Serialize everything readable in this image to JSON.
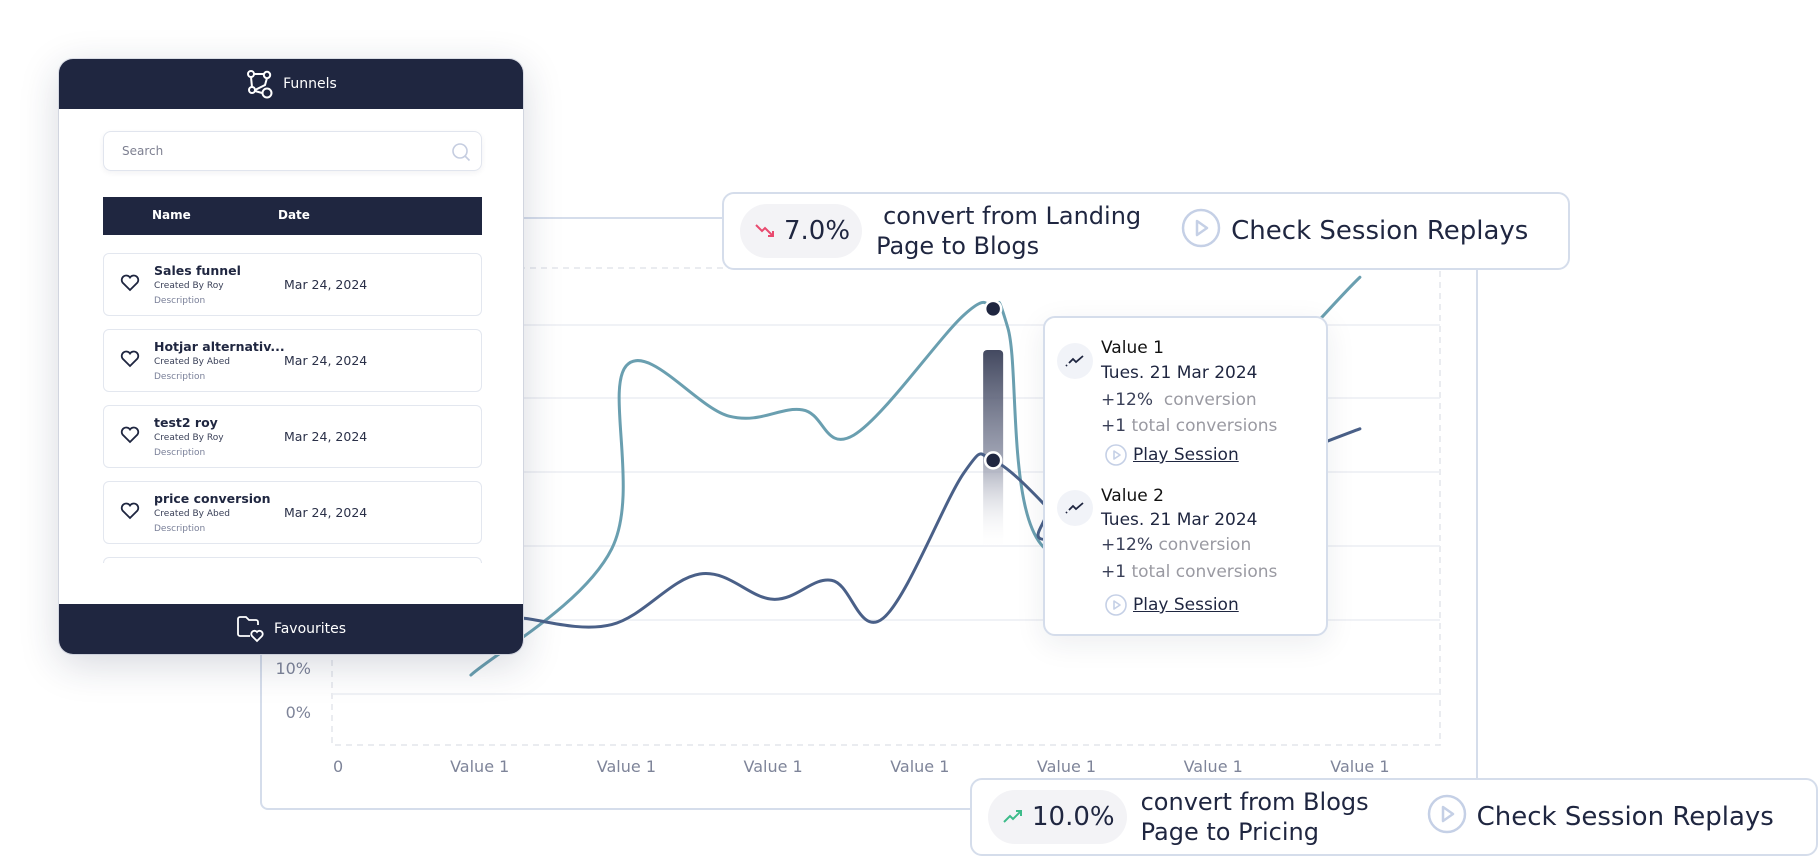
{
  "panel": {
    "title": "Funnels",
    "search_placeholder": "Search",
    "columns": {
      "name": "Name",
      "date": "Date"
    },
    "rows": [
      {
        "name": "Sales funnel",
        "creator": "Created By Roy",
        "description": "Description",
        "date": "Mar 24, 2024"
      },
      {
        "name": "Hotjar alternativ...",
        "creator": "Created By Abed",
        "description": "Description",
        "date": "Mar 24, 2024"
      },
      {
        "name": "test2 roy",
        "creator": "Created By Roy",
        "description": "Description",
        "date": "Mar 24, 2024"
      },
      {
        "name": "price conversion",
        "creator": "Created By Abed",
        "description": "Description",
        "date": "Mar 24, 2024"
      }
    ],
    "footer_label": "Favourites"
  },
  "banner_top": {
    "trend": "down",
    "trend_color": "#e94a6f",
    "percent": "7.0%",
    "text_line1": "convert from Landing",
    "text_line2": "Page to Blogs",
    "replay_label": "Check Session Replays"
  },
  "banner_bottom": {
    "trend": "up",
    "trend_color": "#3dbb8a",
    "percent": "10.0%",
    "text_line1": "convert from Blogs",
    "text_line2": "Page to Pricing",
    "replay_label": "Check Session Replays"
  },
  "tooltip": {
    "entries": [
      {
        "title": "Value 1",
        "date": "Tues. 21 Mar 2024",
        "conversion_value": "+12%",
        "conversion_label": "conversion",
        "total_value": "+1",
        "total_label": "total conversions",
        "play_label": "Play Session"
      },
      {
        "title": "Value 2",
        "date": "Tues. 21 Mar 2024",
        "conversion_value": "+12%",
        "conversion_label": "conversion",
        "total_value": "+1",
        "total_label": "total conversions",
        "play_label": "Play Session"
      }
    ]
  },
  "chart_data": {
    "type": "line",
    "title": "",
    "xlabel": "",
    "ylabel": "",
    "x": [
      0,
      1,
      2,
      3,
      4,
      5,
      6,
      7
    ],
    "x_tick_labels": [
      "0",
      "Value 1",
      "Value 1",
      "Value 1",
      "Value 1",
      "Value 1",
      "Value 1",
      "Value 1"
    ],
    "y_tick_labels_visible": [
      "10%",
      "0%"
    ],
    "ylim": [
      0,
      70
    ],
    "grid": true,
    "highlight_x": 4.5,
    "series": [
      {
        "name": "Value 1",
        "color": "#6a9fb0",
        "points": [
          [
            0.94,
            3
          ],
          [
            1.9,
            23
          ],
          [
            2.0,
            52
          ],
          [
            2.7,
            44
          ],
          [
            3.2,
            45
          ],
          [
            3.55,
            41
          ],
          [
            4.3,
            60
          ],
          [
            4.5,
            61
          ],
          [
            4.6,
            58
          ],
          [
            5.0,
            22
          ],
          [
            7.0,
            66
          ]
        ]
      },
      {
        "name": "Value 2",
        "color": "#4a6088",
        "points": [
          [
            1.3,
            12
          ],
          [
            1.9,
            11
          ],
          [
            2.5,
            19
          ],
          [
            3.0,
            15
          ],
          [
            3.4,
            18
          ],
          [
            3.75,
            12
          ],
          [
            4.3,
            35
          ],
          [
            4.5,
            37
          ],
          [
            4.85,
            30
          ],
          [
            5.0,
            25
          ],
          [
            7.0,
            42
          ]
        ]
      }
    ]
  }
}
